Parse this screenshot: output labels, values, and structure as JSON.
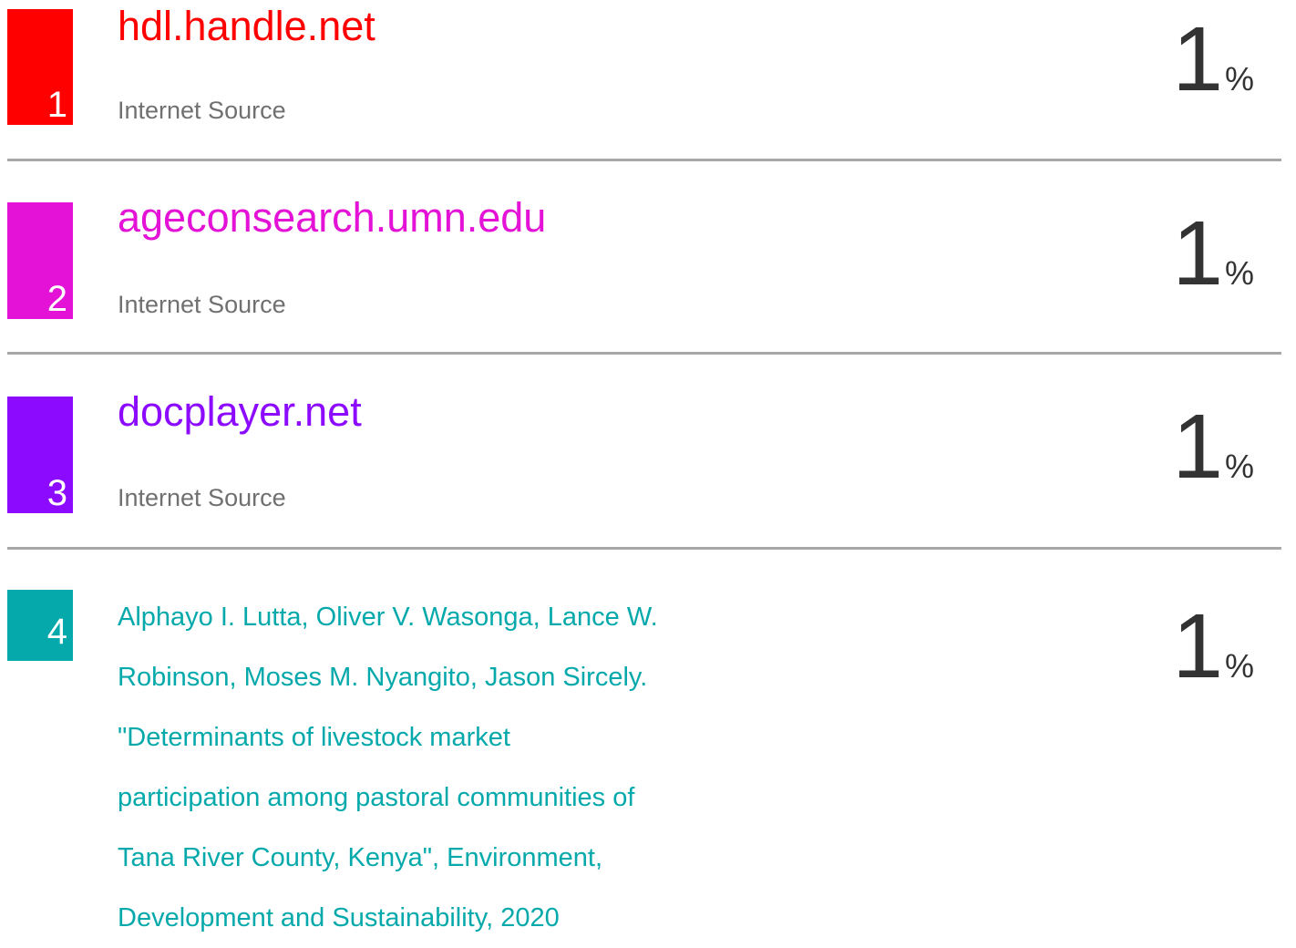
{
  "sources": [
    {
      "rank": "1",
      "title": "hdl.handle.net",
      "type": "Internet Source",
      "percent": "1",
      "percent_symbol": "%",
      "color": "#ff0000"
    },
    {
      "rank": "2",
      "title": "ageconsearch.umn.edu",
      "type": "Internet Source",
      "percent": "1",
      "percent_symbol": "%",
      "color": "#e312d6"
    },
    {
      "rank": "3",
      "title": "docplayer.net",
      "type": "Internet Source",
      "percent": "1",
      "percent_symbol": "%",
      "color": "#8c0bff"
    },
    {
      "rank": "4",
      "percent": "1",
      "percent_symbol": "%",
      "color": "#05a9ab",
      "citation_lines": [
        "Alphayo I. Lutta, Oliver V. Wasonga, Lance W.",
        "Robinson, Moses M. Nyangito, Jason Sircely.",
        "\"Determinants of livestock market",
        "participation among pastoral communities of",
        "Tana River County, Kenya\", Environment,",
        "Development and Sustainability, 2020"
      ]
    }
  ]
}
